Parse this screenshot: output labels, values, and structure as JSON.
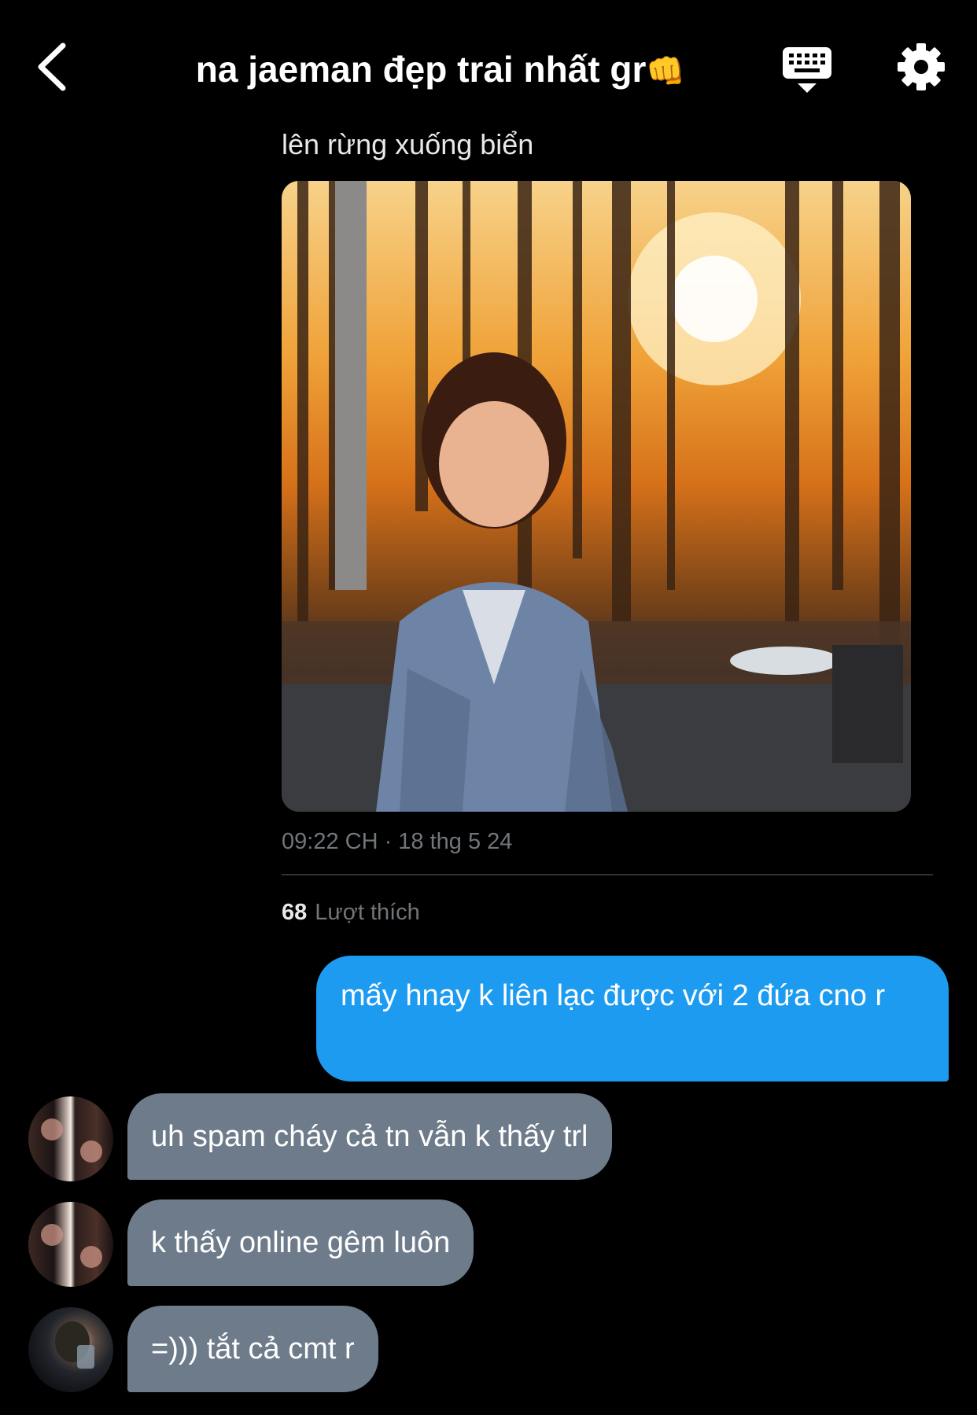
{
  "header": {
    "back_icon": "chevron-left-icon",
    "title": "na jaeman đẹp trai nhất gr",
    "title_emoji": "👊",
    "keyboard_icon": "keyboard-icon",
    "settings_icon": "gear-icon"
  },
  "post": {
    "caption": "lên rừng xuống biển",
    "timestamp": "09:22 CH · 18 thg 5 24",
    "likes_count": "68",
    "likes_label": "Lượt thích"
  },
  "messages": [
    {
      "sender": "me",
      "text": "mấy hnay k liên lạc được với 2 đứa cno r"
    },
    {
      "sender": "them",
      "text": "uh spam cháy cả tn vẫn k thấy trl"
    },
    {
      "sender": "them",
      "text": "k thấy online gêm luôn"
    },
    {
      "sender": "them",
      "text": "=))) tắt cả cmt r"
    }
  ],
  "colors": {
    "background": "#000000",
    "my_bubble": "#1d9bf0",
    "their_bubble": "#6e7b8a",
    "muted_text": "#71767b"
  }
}
